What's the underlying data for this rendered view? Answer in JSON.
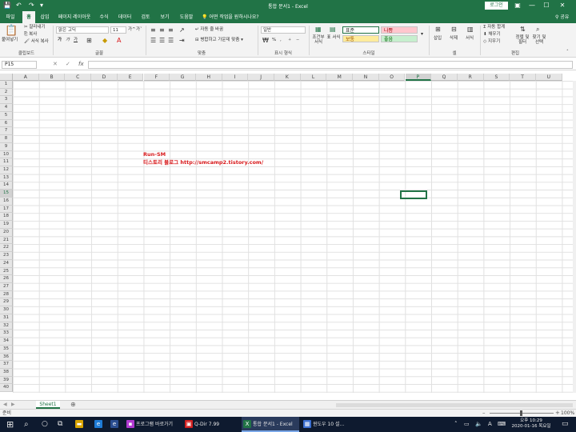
{
  "title_bar": {
    "document_title": "통합 문서1  -  Excel",
    "login_label": "로그인",
    "qa_save": "💾",
    "qa_undo": "↶",
    "qa_redo": "↷",
    "qa_more": "▾",
    "restore_icon": "▣",
    "minimize_icon": "—",
    "maximize_icon": "☐",
    "close_icon": "✕"
  },
  "tabs": [
    "파일",
    "홈",
    "삽입",
    "페이지 레이아웃",
    "수식",
    "데이터",
    "검토",
    "보기",
    "도움말"
  ],
  "active_tab": "홈",
  "tell_me": "어떤 작업을 원하시나요?",
  "share": "공유",
  "ribbon": {
    "clipboard": {
      "paste": "붙여넣기",
      "cut": "잘라내기",
      "copy": "복사",
      "format_painter": "서식 복사",
      "label": "클립보드"
    },
    "font": {
      "font_name": "맑은 고딕",
      "font_size": "11",
      "bold": "가",
      "italic": "가",
      "underline": "가",
      "grow": "가^",
      "shrink": "가ˇ",
      "label": "글꼴"
    },
    "alignment": {
      "wrap": "자동 줄 바꿈",
      "merge": "병합하고 가운데 맞춤",
      "label": "맞춤"
    },
    "number": {
      "format": "일반",
      "percent": "%",
      "comma": ",",
      "label": "표시 형식"
    },
    "styles": {
      "conditional": "조건부 서식",
      "table": "표 서식",
      "cells": [
        "표준",
        "나쁨",
        "보통",
        "좋음"
      ],
      "label": "스타일"
    },
    "cells": {
      "insert": "삽입",
      "delete": "삭제",
      "format": "서식",
      "label": "셀"
    },
    "editing": {
      "autosum": "자동 합계",
      "fill": "채우기",
      "clear": "지우기",
      "sort_filter": "정렬 및 필터",
      "find_select": "찾기 및 선택",
      "label": "편집"
    }
  },
  "formula_bar": {
    "name_box": "P15",
    "cancel": "✕",
    "enter": "✓",
    "fx": "fx",
    "content": ""
  },
  "columns": [
    "A",
    "B",
    "C",
    "D",
    "E",
    "F",
    "G",
    "H",
    "I",
    "J",
    "K",
    "L",
    "M",
    "N",
    "O",
    "P",
    "Q",
    "R",
    "S",
    "T",
    "U"
  ],
  "selected_column": "P",
  "rows": [
    "1",
    "2",
    "3",
    "4",
    "5",
    "6",
    "7",
    "8",
    "9",
    "10",
    "11",
    "12",
    "13",
    "14",
    "15",
    "16",
    "17",
    "18",
    "19",
    "20",
    "21",
    "22",
    "23",
    "24",
    "25",
    "26",
    "27",
    "28",
    "29",
    "30",
    "31",
    "32",
    "33",
    "34",
    "35",
    "36",
    "37",
    "38",
    "39",
    "40"
  ],
  "selected_row": "15",
  "cells": {
    "F9": "Run-SM",
    "F10": "티스토리 블로그 http://smcamp2.tistory.com/"
  },
  "sheet_tabs": [
    "Sheet1"
  ],
  "add_sheet": "⊕",
  "status": {
    "ready": "준비",
    "zoom": "100%",
    "zoom_minus": "–",
    "zoom_plus": "+"
  },
  "taskbar": {
    "start_icon": "⊞",
    "search_icon": "⌕",
    "windows": [
      "프로그램 바로가기",
      "Q-Dir 7.99",
      "통합 문서1 - Excel",
      "윈도우 10 설..."
    ],
    "clock_time": "오후 10:29",
    "clock_date": "2020-01-16 목요일"
  },
  "colors": {
    "excel_green": "#217346",
    "cell_text_red": "#d8191b",
    "taskbar_bg": "#0e1a2f",
    "bad_fill": "#ffc7ce",
    "neutral_fill": "#ffeb9c",
    "good_fill": "#c6efce"
  }
}
